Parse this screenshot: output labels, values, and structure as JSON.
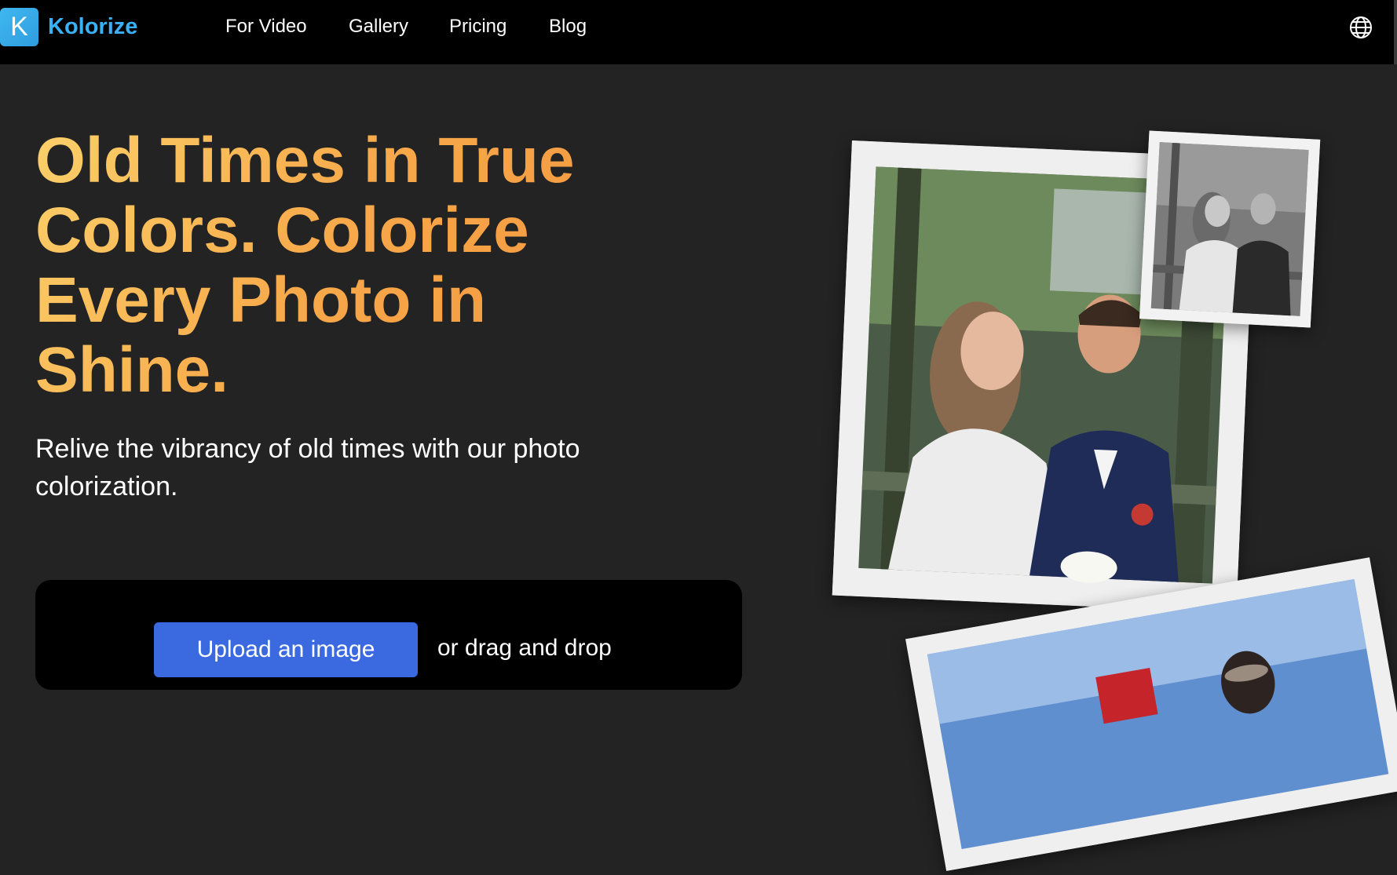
{
  "brand": {
    "logo_letter": "K",
    "name": "Kolorize",
    "accent": "#3ab0f5"
  },
  "nav": {
    "links": [
      {
        "label": "For Video"
      },
      {
        "label": "Gallery"
      },
      {
        "label": "Pricing"
      },
      {
        "label": "Blog"
      }
    ],
    "language_icon": "globe-icon"
  },
  "hero": {
    "title_lines": [
      "Old Times in True",
      "Colors. Colorize",
      "Every Photo in",
      "Shine."
    ],
    "subtitle_lines": [
      "Relive the vibrancy of old times with our photo",
      "colorization."
    ],
    "title_gradient": [
      "#fbd06a",
      "#f2913b"
    ]
  },
  "upload": {
    "button_label": "Upload an image",
    "hint": "or drag and drop",
    "button_color": "#3b6ae0"
  }
}
